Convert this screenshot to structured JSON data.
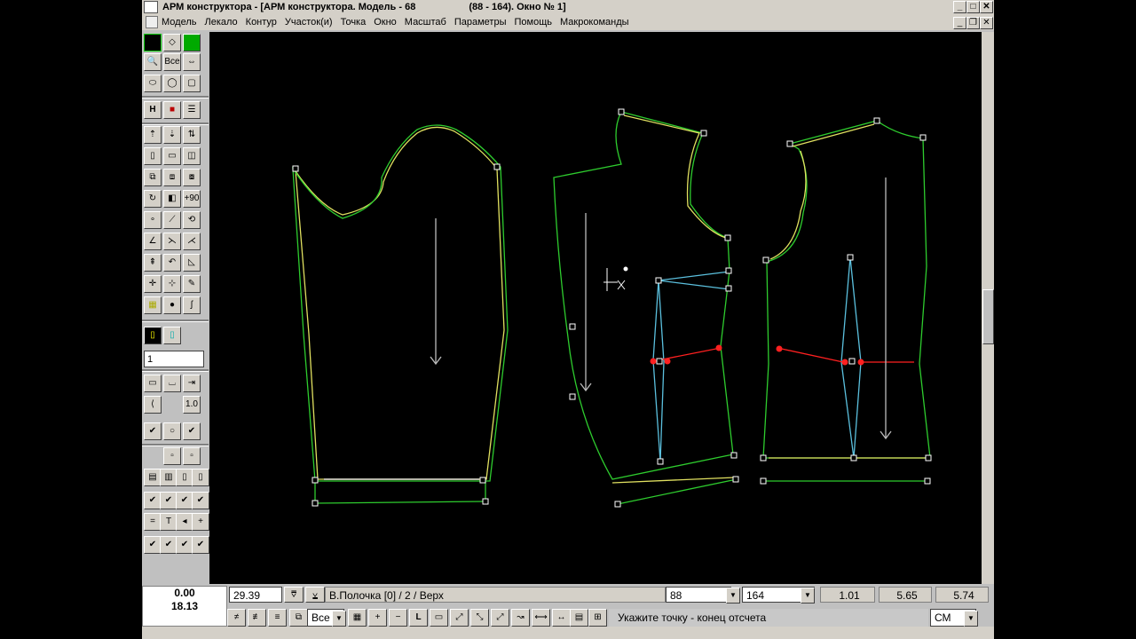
{
  "window": {
    "title": "АРМ конструктора - [АРМ конструктора. Модель - 68",
    "title_info": "(88 - 164). Окно № 1]",
    "btn_minimize": "_",
    "btn_maximize": "□",
    "btn_close": "✕",
    "doc_minimize": "_",
    "doc_restore": "❐",
    "doc_close": "✕"
  },
  "menu": [
    "Модель",
    "Лекало",
    "Контур",
    "Участок(и)",
    "Точка",
    "Окно",
    "Масштаб",
    "Параметры",
    "Помощь",
    "Макрокоманды"
  ],
  "toolbox": {
    "all_label": "Все",
    "rotate_label": "+90",
    "h_label": "H",
    "input_value": "1",
    "scale_label": "1.0"
  },
  "status": {
    "coord_x": "0.00",
    "coord_y": "18.13",
    "value_field": "29.39",
    "piece_name": "В.Полочка [0] / 2 / Верх",
    "size": "88",
    "height": "164",
    "val1": "1.01",
    "val2": "5.65",
    "val3": "5.74",
    "filter": "Все",
    "prompt": "Укажите точку - конец отсчета",
    "units": "СМ",
    "line_label": "L"
  }
}
